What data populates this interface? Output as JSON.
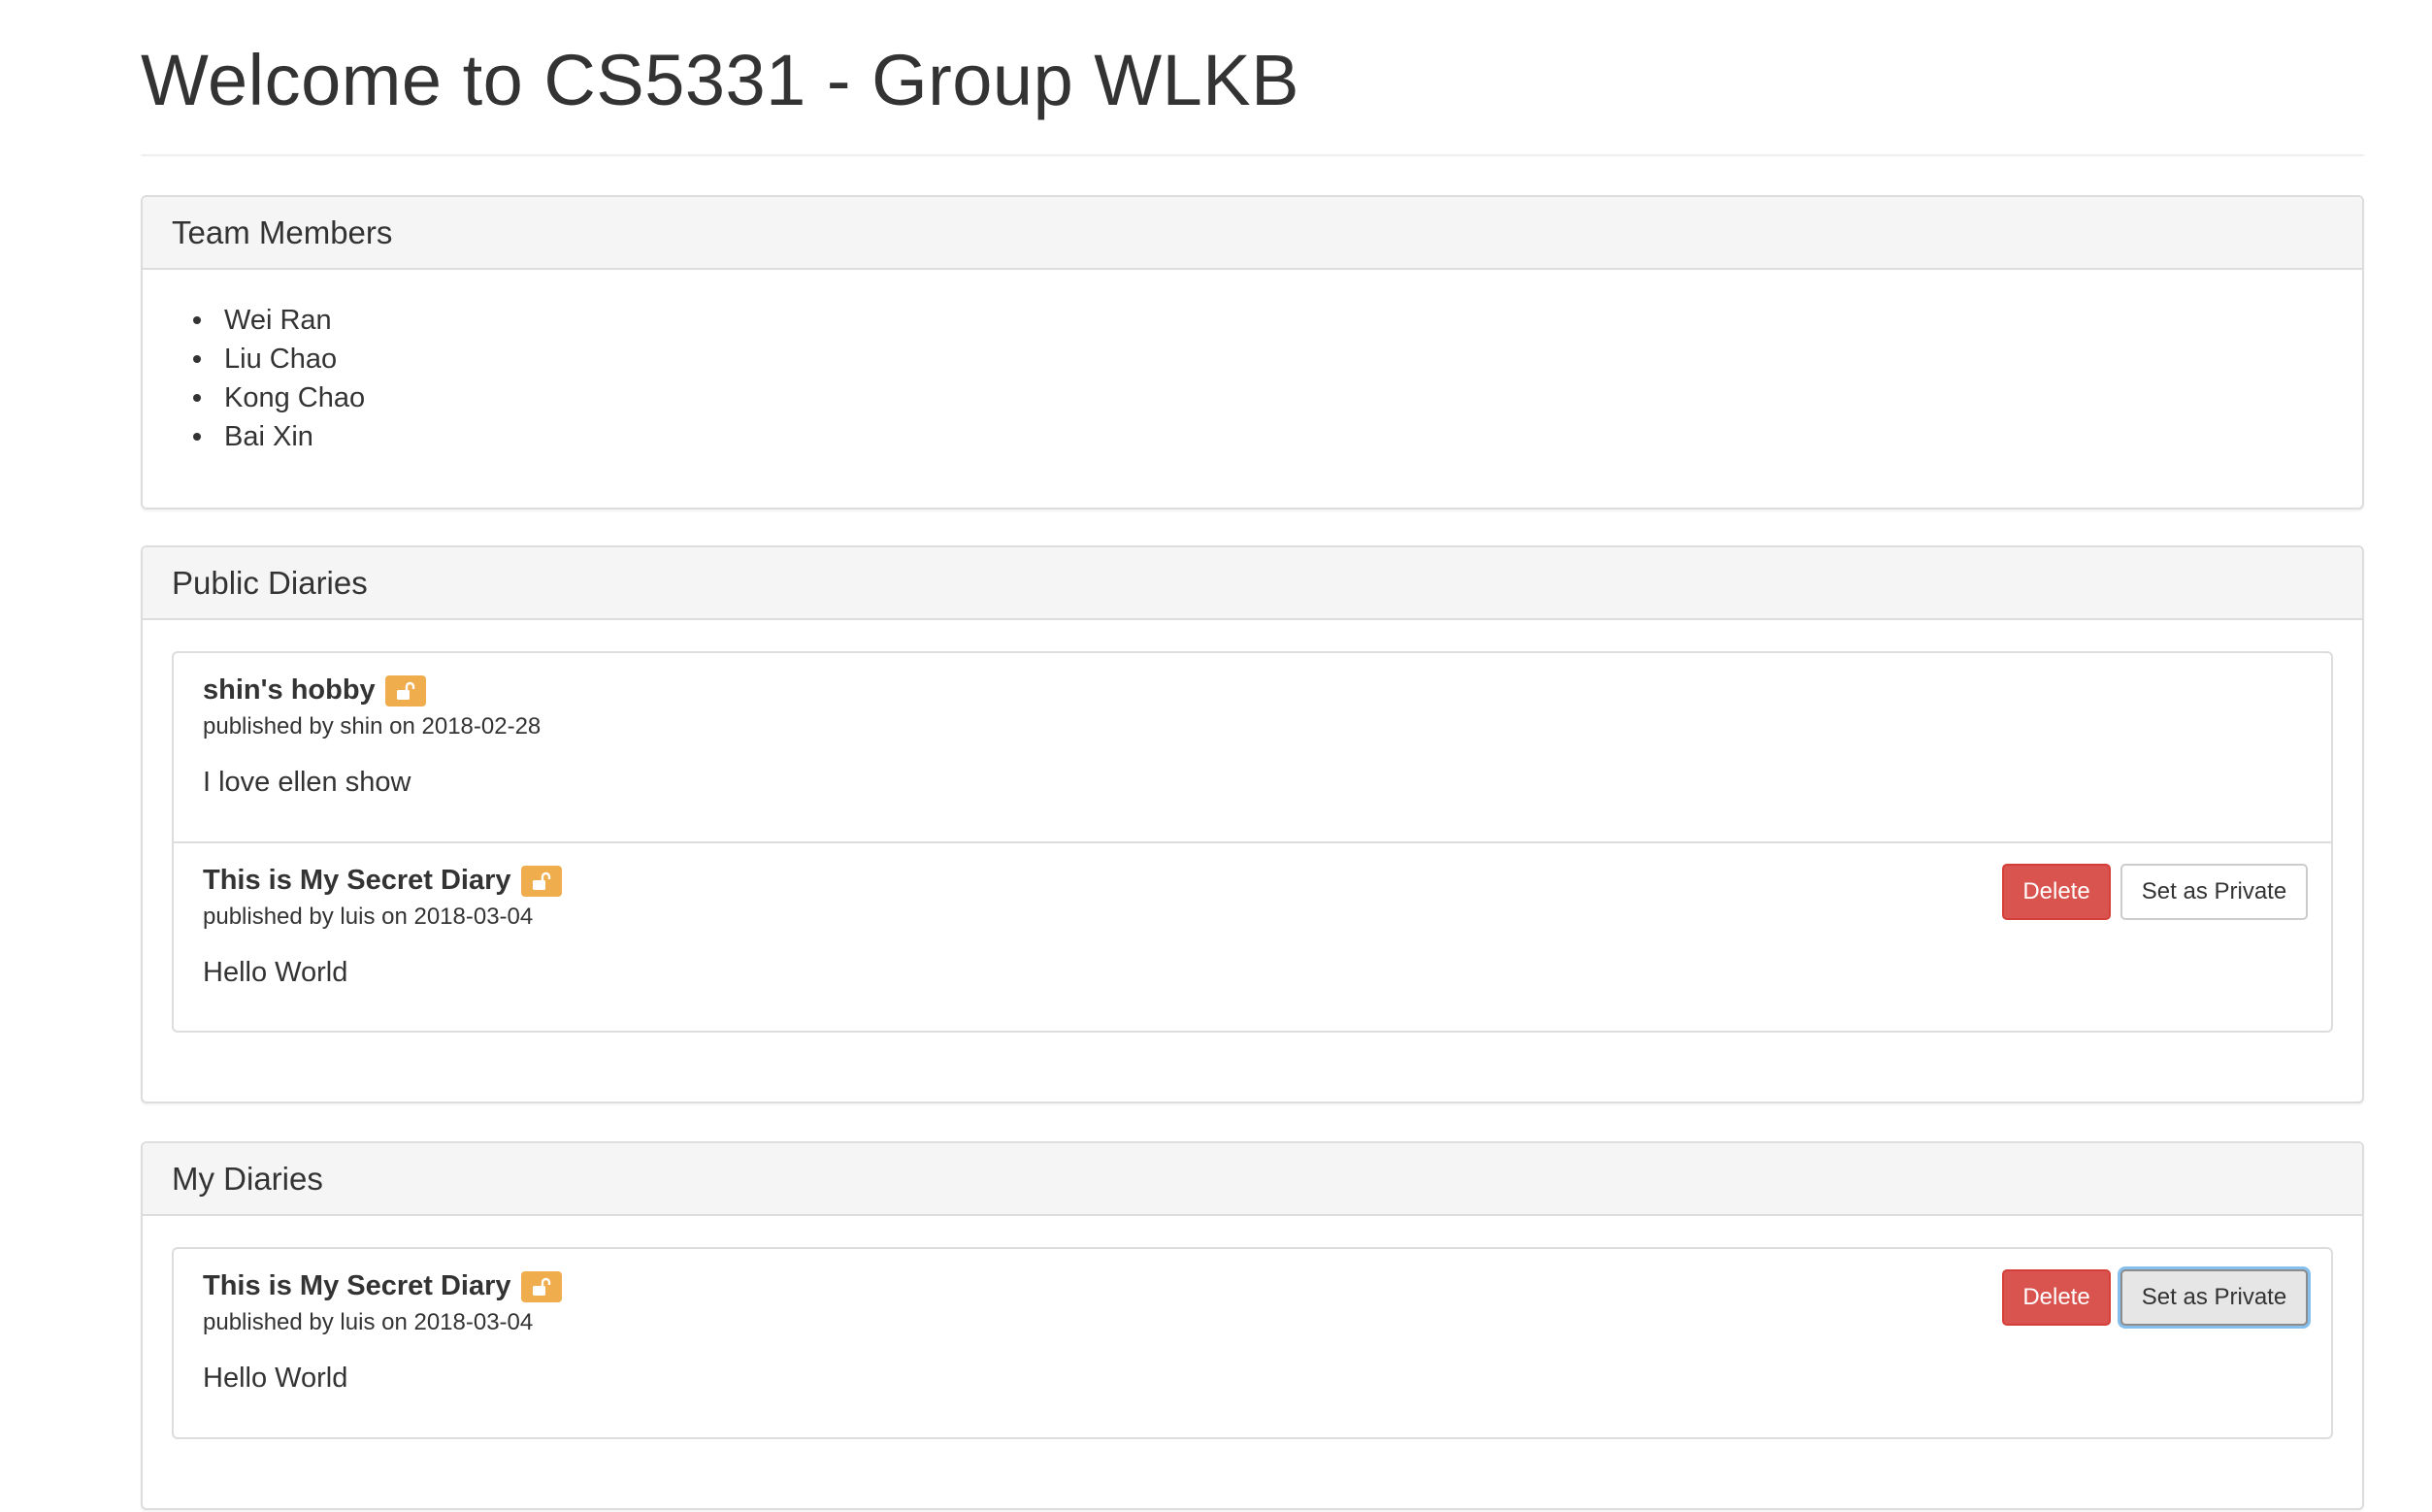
{
  "page": {
    "title": "Welcome to CS5331 - Group WLKB"
  },
  "team_panel": {
    "heading": "Team Members",
    "members": [
      "Wei Ran",
      "Liu Chao",
      "Kong Chao",
      "Bai Xin"
    ]
  },
  "public_panel": {
    "heading": "Public Diaries",
    "entries": [
      {
        "title": "shin's hobby",
        "meta": "published by shin on 2018-02-28",
        "body": "I love ellen show",
        "lock_icon": "unlock-icon"
      },
      {
        "title": "This is My Secret Diary",
        "meta": "published by luis on 2018-03-04",
        "body": "Hello World",
        "lock_icon": "unlock-icon",
        "delete_label": "Delete",
        "private_label": "Set as Private"
      }
    ]
  },
  "my_panel": {
    "heading": "My Diaries",
    "entries": [
      {
        "title": "This is My Secret Diary",
        "meta": "published by luis on 2018-03-04",
        "body": "Hello World",
        "lock_icon": "unlock-icon",
        "delete_label": "Delete",
        "private_label": "Set as Private"
      }
    ]
  },
  "colors": {
    "badge": "#f0ad4e",
    "danger": "#d9534f",
    "panel_heading_bg": "#f5f5f5",
    "border": "#dddddd"
  }
}
